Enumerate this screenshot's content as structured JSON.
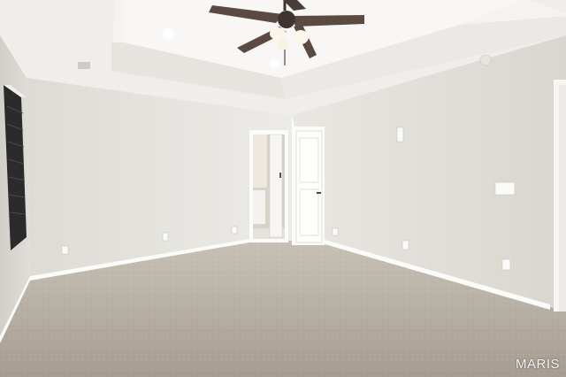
{
  "photo": {
    "watermark": "MARIS",
    "palette": {
      "wall": "#e6e4df",
      "ceiling": "#f2f1ee",
      "carpet": "#b9b1a6",
      "trim": "#fbfbf9"
    }
  }
}
